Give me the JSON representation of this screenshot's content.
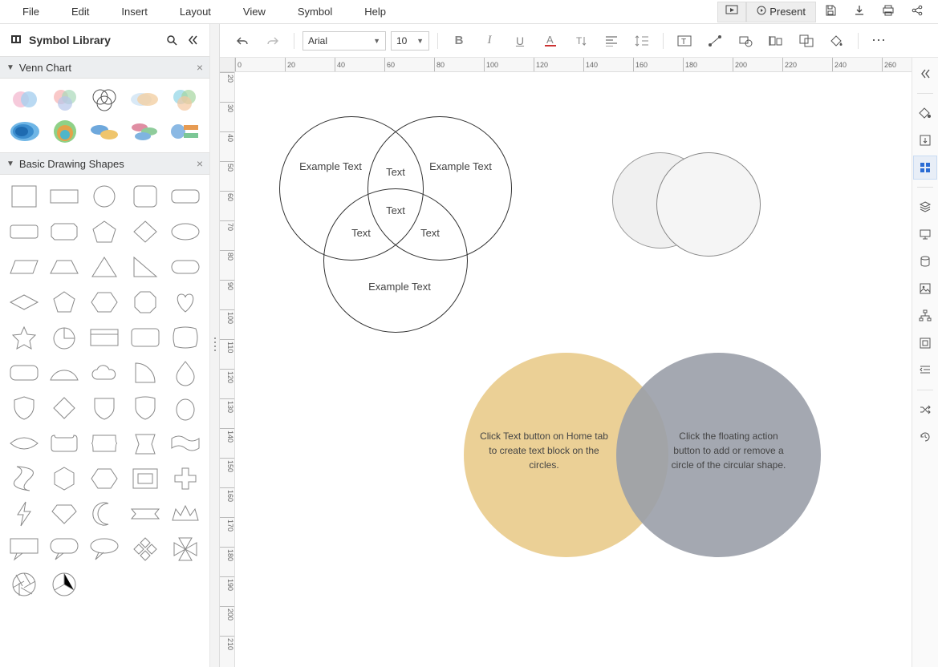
{
  "menu": {
    "file": "File",
    "edit": "Edit",
    "insert": "Insert",
    "layout": "Layout",
    "view": "View",
    "symbol": "Symbol",
    "help": "Help"
  },
  "present_label": "Present",
  "sidebar": {
    "title": "Symbol Library",
    "section_venn": "Venn Chart",
    "section_shapes": "Basic Drawing Shapes"
  },
  "toolbar": {
    "font": "Arial",
    "size": "10"
  },
  "ruler_h": [
    "0",
    "20",
    "40",
    "60",
    "80",
    "100",
    "120",
    "140",
    "160",
    "180",
    "200",
    "220",
    "240",
    "260"
  ],
  "ruler_v": [
    "20",
    "30",
    "40",
    "50",
    "60",
    "70",
    "80",
    "90",
    "100",
    "110",
    "120",
    "130",
    "140",
    "150",
    "160",
    "170",
    "180",
    "190",
    "200",
    "210"
  ],
  "canvas": {
    "venn3": {
      "a": "Example Text",
      "b": "Example Text",
      "c": "Example Text",
      "ab": "Text",
      "ac": "Text",
      "bc": "Text",
      "abc": "Text"
    },
    "venn2_color": {
      "left": "Click Text button on Home tab to create text block on the circles.",
      "right": "Click the floating action button to add or remove a circle of the circular shape."
    }
  }
}
